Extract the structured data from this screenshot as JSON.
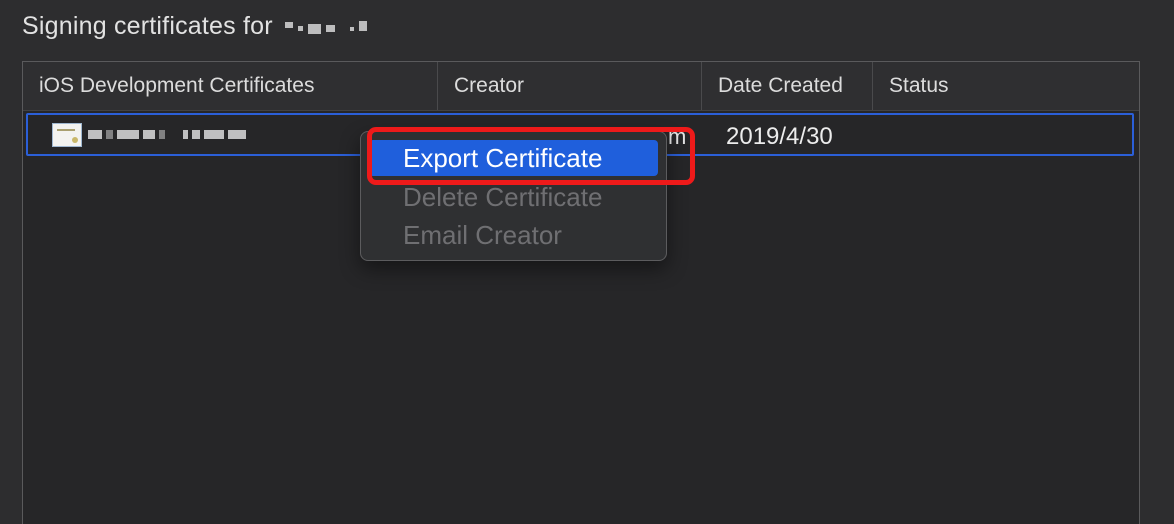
{
  "header": {
    "title": "Signing certificates for"
  },
  "table": {
    "columns": [
      {
        "label": "iOS Development Certificates"
      },
      {
        "label": "Creator"
      },
      {
        "label": "Date Created"
      },
      {
        "label": "Status"
      }
    ],
    "rows": [
      {
        "creator_visible": "m",
        "date_created": "2019/4/30",
        "status": ""
      }
    ]
  },
  "context_menu": {
    "items": [
      {
        "label": "Export Certificate",
        "state": "highlighted"
      },
      {
        "label": "Delete Certificate",
        "state": "disabled"
      },
      {
        "label": "Email Creator",
        "state": "disabled"
      }
    ]
  },
  "colors": {
    "selection_blue": "#2b5fd8",
    "menu_highlight": "#1f5fdc",
    "annotation_red": "#ee1a1a"
  },
  "icons": {
    "row_icon": "certificate-icon"
  }
}
